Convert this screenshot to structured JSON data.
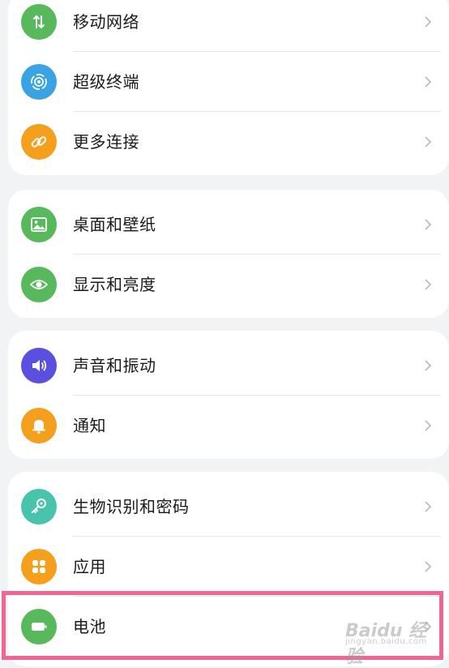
{
  "colors": {
    "page_bg": "#f1f3f5",
    "card_bg": "#ffffff",
    "highlight": "#f06592",
    "green": "#58b85c",
    "blue": "#3aa3e3",
    "orange": "#f4a01c",
    "purple": "#5b4fe0",
    "teal": "#48c4ad"
  },
  "groups": [
    {
      "items": [
        {
          "label": "移动网络",
          "icon": "mobile-network-icon",
          "color": "#58b85c"
        },
        {
          "label": "超级终端",
          "icon": "super-device-icon",
          "color": "#3aa3e3"
        },
        {
          "label": "更多连接",
          "icon": "link-icon",
          "color": "#f4a01c"
        }
      ]
    },
    {
      "items": [
        {
          "label": "桌面和壁纸",
          "icon": "wallpaper-icon",
          "color": "#58b85c"
        },
        {
          "label": "显示和亮度",
          "icon": "eye-icon",
          "color": "#58b85c"
        }
      ]
    },
    {
      "items": [
        {
          "label": "声音和振动",
          "icon": "speaker-icon",
          "color": "#5b4fe0"
        },
        {
          "label": "通知",
          "icon": "bell-icon",
          "color": "#f4a01c"
        }
      ]
    },
    {
      "items": [
        {
          "label": "生物识别和密码",
          "icon": "key-icon",
          "color": "#48c4ad"
        },
        {
          "label": "应用",
          "icon": "apps-grid-icon",
          "color": "#f4a01c"
        },
        {
          "label": "电池",
          "icon": "battery-icon",
          "color": "#58b85c"
        }
      ]
    }
  ],
  "watermark": {
    "main": "Baidu 经验",
    "sub": "jingyan.baidu.com"
  }
}
